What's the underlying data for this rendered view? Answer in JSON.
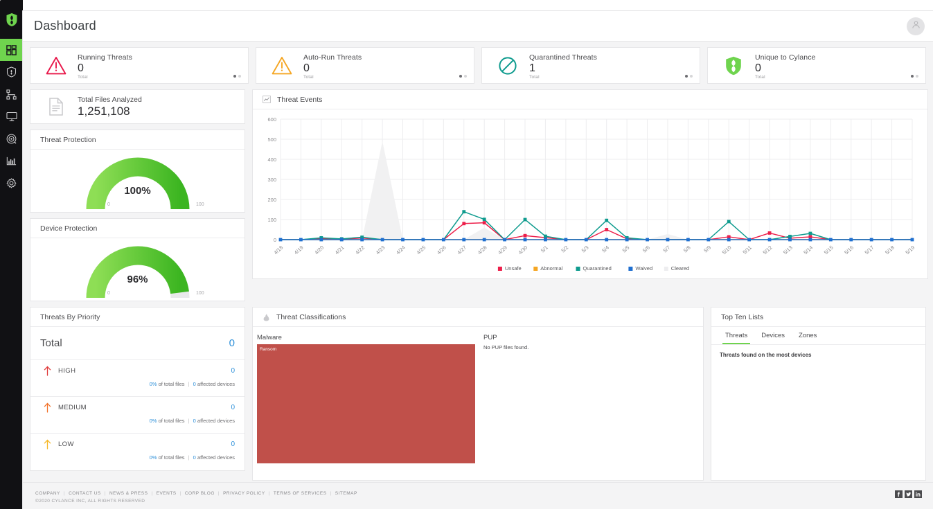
{
  "app": {
    "title": "Dashboard",
    "avatar_icon": "user-avatar-icon"
  },
  "sidebar": {
    "logo": "cylance-logo",
    "items": [
      {
        "name": "dashboard",
        "icon": "dashboard-grid-icon",
        "active": true
      },
      {
        "name": "protection",
        "icon": "shield-icon",
        "active": false
      },
      {
        "name": "zones",
        "icon": "zones-hierarchy-icon",
        "active": false
      },
      {
        "name": "devices",
        "icon": "monitor-icon",
        "active": false
      },
      {
        "name": "detection",
        "icon": "radar-icon",
        "active": false
      },
      {
        "name": "reports",
        "icon": "bar-chart-icon",
        "active": false
      },
      {
        "name": "settings",
        "icon": "gear-icon",
        "active": false
      }
    ]
  },
  "stats": [
    {
      "label": "Running Threats",
      "value": "0",
      "sub": "Total",
      "icon": "warning-triangle-red-icon",
      "color": "#e8174a"
    },
    {
      "label": "Auto-Run Threats",
      "value": "0",
      "sub": "Total",
      "icon": "warning-triangle-orange-icon",
      "color": "#f5a623"
    },
    {
      "label": "Quarantined Threats",
      "value": "1",
      "sub": "Total",
      "icon": "no-entry-icon",
      "color": "#0e9b8e"
    },
    {
      "label": "Unique to Cylance",
      "value": "0",
      "sub": "Total",
      "icon": "cylance-shield-green-icon",
      "color": "#6fd44e"
    }
  ],
  "total_files": {
    "label": "Total Files Analyzed",
    "value": "1,251,108",
    "icon": "document-icon"
  },
  "threat_protection": {
    "title": "Threat Protection",
    "percent_label": "100%",
    "percent": 100,
    "min_label": "0",
    "max_label": "100"
  },
  "device_protection": {
    "title": "Device Protection",
    "percent_label": "96%",
    "percent": 96,
    "min_label": "0",
    "max_label": "100"
  },
  "threat_events": {
    "title": "Threat Events",
    "icon": "line-chart-icon"
  },
  "chart_data": {
    "type": "line",
    "title": "Threat Events",
    "xlabel": "",
    "ylabel": "",
    "ylim": [
      0,
      600
    ],
    "yticks": [
      0,
      100,
      200,
      300,
      400,
      500,
      600
    ],
    "grid": true,
    "legend_position": "bottom",
    "categories": [
      "4/18",
      "4/19",
      "4/20",
      "4/21",
      "4/22",
      "4/23",
      "4/24",
      "4/25",
      "4/26",
      "4/27",
      "4/28",
      "4/29",
      "4/30",
      "5/1",
      "5/2",
      "5/3",
      "5/4",
      "5/5",
      "5/6",
      "5/7",
      "5/8",
      "5/9",
      "5/10",
      "5/11",
      "5/12",
      "5/13",
      "5/14",
      "5/15",
      "5/16",
      "5/17",
      "5/18",
      "5/19"
    ],
    "series": [
      {
        "name": "Unsafe",
        "color": "#ed1f4a",
        "values": [
          0,
          0,
          5,
          2,
          8,
          0,
          0,
          0,
          0,
          80,
          84,
          0,
          20,
          10,
          0,
          0,
          50,
          4,
          0,
          0,
          0,
          0,
          14,
          0,
          33,
          7,
          14,
          0,
          0,
          0,
          0,
          0
        ]
      },
      {
        "name": "Abnormal",
        "color": "#f5a623",
        "values": [
          0,
          0,
          0,
          0,
          0,
          0,
          0,
          0,
          0,
          0,
          0,
          0,
          0,
          0,
          0,
          0,
          0,
          0,
          0,
          0,
          0,
          0,
          0,
          0,
          0,
          0,
          0,
          0,
          0,
          0,
          0,
          0
        ]
      },
      {
        "name": "Quarantined",
        "color": "#0e9b8e",
        "values": [
          0,
          0,
          9,
          4,
          12,
          0,
          0,
          0,
          0,
          139,
          101,
          0,
          100,
          17,
          0,
          0,
          96,
          9,
          0,
          0,
          0,
          0,
          90,
          0,
          0,
          16,
          31,
          0,
          0,
          0,
          0,
          0
        ]
      },
      {
        "name": "Waived",
        "color": "#1f6fd0",
        "values": [
          0,
          0,
          0,
          0,
          0,
          0,
          0,
          0,
          0,
          0,
          0,
          0,
          0,
          0,
          0,
          0,
          0,
          0,
          0,
          0,
          0,
          0,
          0,
          0,
          0,
          0,
          0,
          0,
          0,
          0,
          0,
          0
        ]
      },
      {
        "name": "Cleared",
        "color": "#eeeeee",
        "values": [
          0,
          0,
          0,
          0,
          0,
          490,
          0,
          0,
          0,
          0,
          60,
          0,
          0,
          0,
          0,
          0,
          0,
          0,
          0,
          28,
          0,
          0,
          0,
          0,
          0,
          0,
          0,
          0,
          0,
          0,
          0,
          6
        ]
      }
    ]
  },
  "threats_by_priority": {
    "title": "Threats By Priority",
    "total_label": "Total",
    "total_value": "0",
    "rows": [
      {
        "name": "HIGH",
        "value": "0",
        "pct": "0%",
        "pct_suffix": "of total files",
        "devices": "0",
        "devices_suffix": "affected devices",
        "arrow_color": "#e03c3c"
      },
      {
        "name": "MEDIUM",
        "value": "0",
        "pct": "0%",
        "pct_suffix": "of total files",
        "devices": "0",
        "devices_suffix": "affected devices",
        "arrow_color": "#f2732b"
      },
      {
        "name": "LOW",
        "value": "0",
        "pct": "0%",
        "pct_suffix": "of total files",
        "devices": "0",
        "devices_suffix": "affected devices",
        "arrow_color": "#f5b829"
      }
    ],
    "separator": "|"
  },
  "threat_classifications": {
    "title": "Threat Classifications",
    "icon": "flame-icon",
    "malware": {
      "heading": "Malware",
      "block_label": "Ransom",
      "color": "#c0504a"
    },
    "pup": {
      "heading": "PUP",
      "empty_text": "No PUP files found."
    }
  },
  "top_ten": {
    "title": "Top Ten Lists",
    "tabs": [
      {
        "label": "Threats",
        "active": true
      },
      {
        "label": "Devices",
        "active": false
      },
      {
        "label": "Zones",
        "active": false
      }
    ],
    "caption": "Threats found on the most devices"
  },
  "footer": {
    "links": [
      "COMPANY",
      "CONTACT US",
      "NEWS & PRESS",
      "EVENTS",
      "CORP BLOG",
      "PRIVACY POLICY",
      "TERMS OF SERVICES",
      "SITEMAP"
    ],
    "separator": "|",
    "copyright": "©2020 CYLANCE INC, ALL RIGHTS RESERVED",
    "social": [
      {
        "name": "facebook-icon",
        "glyph": "f"
      },
      {
        "name": "twitter-icon",
        "glyph": "t"
      },
      {
        "name": "linkedin-icon",
        "glyph": "in"
      }
    ]
  }
}
